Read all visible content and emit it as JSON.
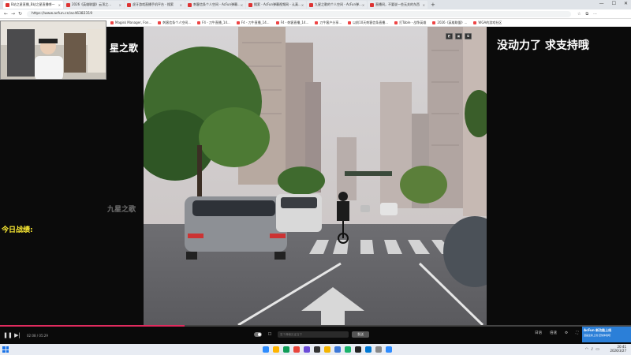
{
  "browser": {
    "tabs": [
      {
        "label": "B站之星直播_B站之星直播哪一",
        "active": true
      },
      {
        "label": "2026《英雄联盟》云顶之..."
      },
      {
        "label": "虎牙游戏直播手机平台 - 搜索"
      },
      {
        "label": "刺客信条个人空间 - AcFun弹幕..."
      },
      {
        "label": "搜索 - AcFun弹幕视频网 - 认真..."
      },
      {
        "label": "九星之歌的个人空间 - AcFun弹..."
      },
      {
        "label": "直播间，不要说一些无关的东西"
      }
    ],
    "new_tab": "+",
    "url": "https://www.acfun.cn/ac46382319",
    "bookmarks": [
      "Magisk Manager, Fon...",
      "刺客信条个人空间...",
      "F4 - 刀牛直播_14...",
      "F4 - 刀牛直播_14...",
      "F4 - 刺客直播_14...",
      "刀牛客户分享...",
      "以前10天刺客信条直播...",
      "打Table - 战争英雄",
      "2026《英雄联盟》...",
      "WGA的游戏社区"
    ]
  },
  "stream": {
    "title_left": "星之歌",
    "watermark": "九星之歌",
    "today_label": "今日战绩:",
    "support_text": "没动力了 求支持哦"
  },
  "player": {
    "progress": 0.38,
    "time": "02:08 / 05:29",
    "danmaku_placeholder": "发个弹幕见证当下",
    "send_label": "发送",
    "right_controls": [
      "日语",
      "倍速",
      "⚙",
      "⛶",
      "◱"
    ]
  },
  "notification": {
    "title": "AcFun 新功能上线",
    "body": "漫画全新上线 赶快体验吧"
  },
  "taskbar": {
    "time": "20:41",
    "date": "2026/3/27",
    "app_colors": [
      "#2d8cff",
      "#ffb400",
      "#0f9d58",
      "#e8453c",
      "#6b4bd8",
      "#333333",
      "#f4b400",
      "#3c78d8",
      "#1bb36b",
      "#222222",
      "#0078d4",
      "#888888",
      "#2d8cff"
    ]
  },
  "colors": {
    "progress_fill": "#e02b5e",
    "accent": "#2b7fd8",
    "highlight_text": "#ffee33"
  }
}
